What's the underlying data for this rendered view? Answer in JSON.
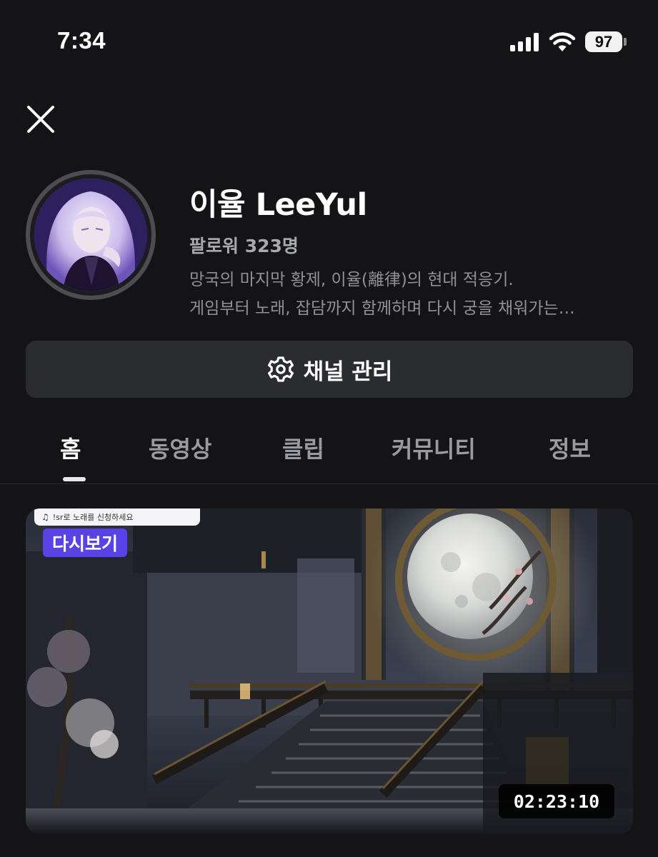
{
  "status_bar": {
    "time": "7:34",
    "battery": "97",
    "icons": [
      "cellular-signal-icon",
      "wifi-icon",
      "battery-icon"
    ]
  },
  "header": {
    "close_icon": "close-icon"
  },
  "profile": {
    "avatar_icon": "avatar",
    "name": "이율 LeeYul",
    "followers_label": "팔로워",
    "followers_count": "323명",
    "description_line1": "망국의 마지막 황제, 이율(離律)의 현대 적응기.",
    "description_line2": "게임부터 노래, 잡담까지 함께하며 다시 궁을 채워가는…"
  },
  "manage_button": {
    "label": "채널 관리",
    "icon": "gear-icon"
  },
  "tabs": [
    {
      "label": "홈",
      "active": true
    },
    {
      "label": "동영상",
      "active": false
    },
    {
      "label": "클립",
      "active": false
    },
    {
      "label": "커뮤니티",
      "active": false
    },
    {
      "label": "정보",
      "active": false
    }
  ],
  "video": {
    "notice": "!sr로 노래를 신청하세요",
    "notice_icon": "music-note-icon",
    "badge": "다시보기",
    "duration": "02:23:10",
    "colors": {
      "badge_bg": "#5a43e6",
      "duration_bg": "#000000"
    }
  },
  "colors": {
    "background": "#141416",
    "button_bg": "#2b2c30",
    "muted_text": "#8f9098"
  }
}
